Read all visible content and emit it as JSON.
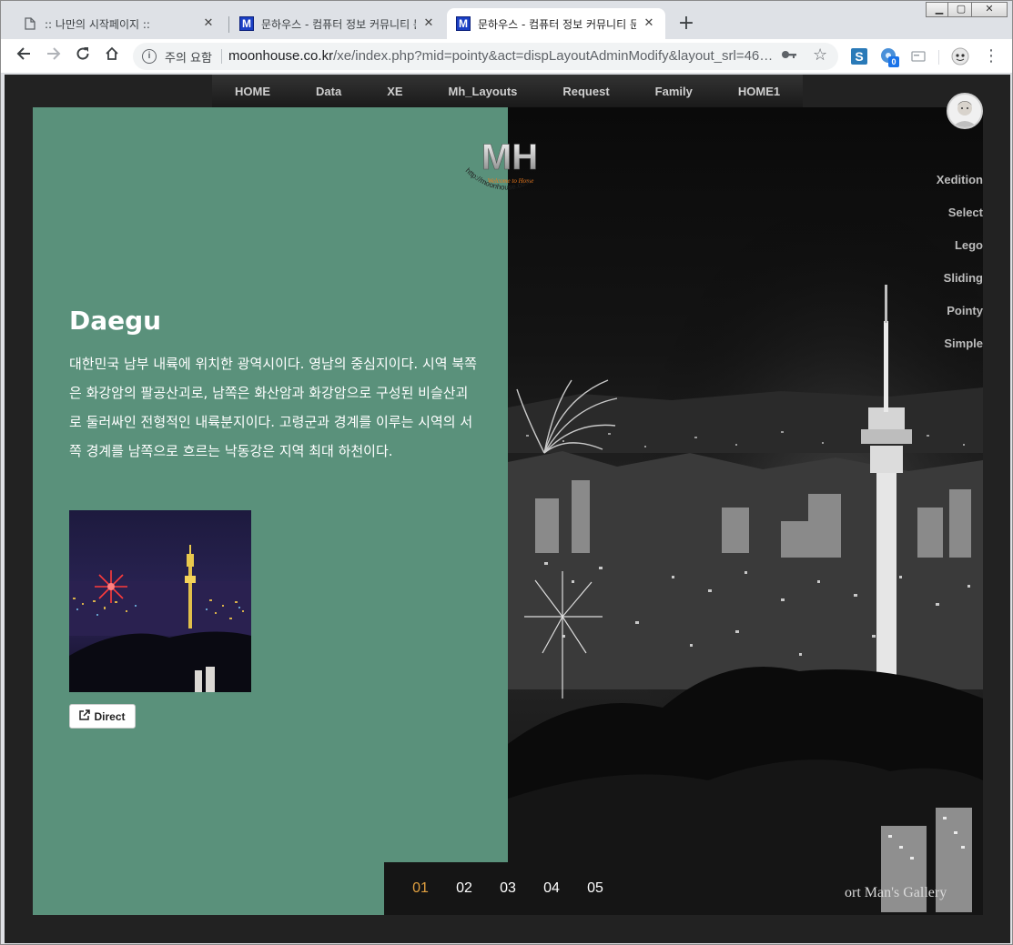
{
  "browser": {
    "tabs": [
      {
        "title": ":: 나만의 시작페이지 ::",
        "favicon": "document-icon",
        "active": false
      },
      {
        "title": "문하우스 - 컴퓨터 정보 커뮤니티 문하",
        "favicon": "M",
        "active": false
      },
      {
        "title": "문하우스 - 컴퓨터 정보 커뮤니티 문하",
        "favicon": "M",
        "active": true
      }
    ],
    "security_label": "주의 요함",
    "url_host": "moonhouse.co.kr",
    "url_path": "/xe/index.php?mid=pointy&act=dispLayoutAdminModify&layout_srl=46…",
    "extension_badge": "0"
  },
  "nav": {
    "items": [
      "HOME",
      "Data",
      "XE",
      "Mh_Layouts",
      "Request",
      "Family",
      "HOME1"
    ]
  },
  "logo": {
    "text": "MH",
    "tagline": "Welcome to Home",
    "arc_text": "http://moonhouse.co.kr"
  },
  "slide": {
    "title": "Daegu",
    "text": "대한민국 남부 내륙에 위치한 광역시이다. 영남의 중심지이다. 시역 북쪽은 화강암의 팔공산괴로, 남쪽은 화산암과 화강암으로 구성된 비슬산괴로 둘러싸인 전형적인 내륙분지이다. 고령군과 경계를 이루는 시역의 서쪽 경계를 남쪽으로 흐르는 낙동강은 지역 최대 하천이다.",
    "button_label": "Direct",
    "watermark": "ort  Man's Gallery"
  },
  "side_menu": {
    "items": [
      "Xedition",
      "Select",
      "Lego",
      "Sliding",
      "Pointy",
      "Simple"
    ]
  },
  "pager": {
    "pages": [
      "01",
      "02",
      "03",
      "04",
      "05"
    ],
    "active_index": 0
  },
  "colors": {
    "slide_left_bg": "#5a917b",
    "page_bg": "#222222",
    "active_page": "#e0a040"
  }
}
